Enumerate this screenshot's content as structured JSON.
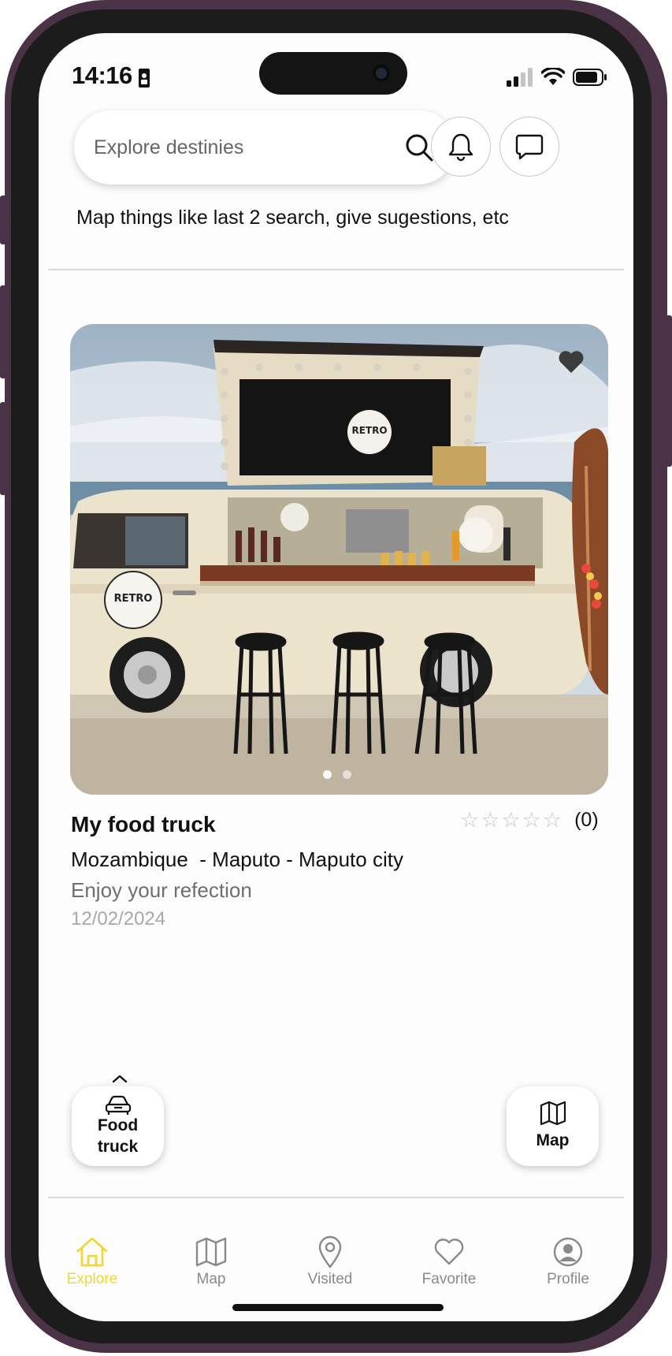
{
  "status_bar": {
    "time": "14:16"
  },
  "search": {
    "placeholder": "Explore destinies"
  },
  "hint": "Map things like last 2 search, give sugestions, etc",
  "listing": {
    "title": "My food truck",
    "rating_count": "(0)",
    "stars": 0,
    "location": "Mozambique  - Maputo - Maputo city",
    "description": "Enjoy your refection",
    "date": "12/02/2024",
    "image_signs": [
      "RETRO",
      "RETRO"
    ],
    "carousel_pages": 2,
    "carousel_active": 1
  },
  "floating": {
    "category_line1": "Food",
    "category_line2": "truck",
    "map_label": "Map"
  },
  "tabs": [
    {
      "label": "Explore",
      "icon": "home-icon",
      "active": true
    },
    {
      "label": "Map",
      "icon": "map-icon",
      "active": false
    },
    {
      "label": "Visited",
      "icon": "location-pin-icon",
      "active": false
    },
    {
      "label": "Favorite",
      "icon": "heart-icon",
      "active": false
    },
    {
      "label": "Profile",
      "icon": "profile-icon",
      "active": false
    }
  ],
  "colors": {
    "accent": "#f4d63a",
    "frame": "#4a3346",
    "inactive_tab": "#8a8a8a"
  }
}
